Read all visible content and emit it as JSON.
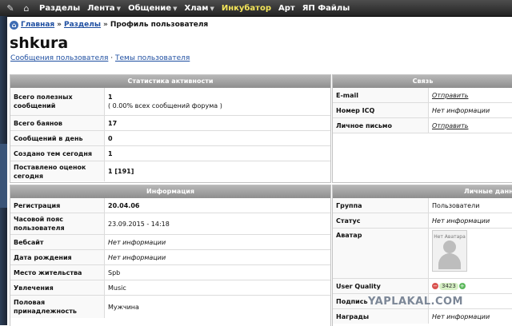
{
  "topnav": {
    "items": [
      {
        "label": "Разделы",
        "caret": false,
        "highlight": false
      },
      {
        "label": "Лента",
        "caret": true,
        "highlight": false
      },
      {
        "label": "Общение",
        "caret": true,
        "highlight": false
      },
      {
        "label": "Хлам",
        "caret": true,
        "highlight": false
      },
      {
        "label": "Инкубатор",
        "caret": false,
        "highlight": true
      },
      {
        "label": "Арт",
        "caret": false,
        "highlight": false
      },
      {
        "label": "ЯП Файлы",
        "caret": false,
        "highlight": false
      }
    ]
  },
  "breadcrumb": {
    "home": "Главная",
    "section": "Разделы",
    "current": "Профиль пользователя",
    "sep": "»"
  },
  "profile": {
    "username": "shkura",
    "links": {
      "posts": "Сообщения пользователя",
      "dot": "·",
      "topics": "Темы пользователя"
    }
  },
  "stats": {
    "title": "Статистика активности",
    "rows": [
      {
        "key": "Всего полезных сообщений",
        "value": "1",
        "sub": "( 0.00% всех сообщений форума )"
      },
      {
        "key": "Всего баянов",
        "value": "17"
      },
      {
        "key": "Сообщений в день",
        "value": "0"
      },
      {
        "key": "Создано тем сегодня",
        "value": "1"
      },
      {
        "key": "Поставлено оценок сегодня",
        "value": "1 [191]"
      }
    ]
  },
  "contact": {
    "title": "Связь",
    "rows": [
      {
        "key": "E-mail",
        "value": "Отправить"
      },
      {
        "key": "Номер ICQ",
        "value": "Нет информации"
      },
      {
        "key": "Личное письмо",
        "value": "Отправить"
      }
    ]
  },
  "info": {
    "title": "Информация",
    "rows": [
      {
        "key": "Регистрация",
        "value": "20.04.06"
      },
      {
        "key": "Часовой пояс пользователя",
        "value": "23.09.2015 - 14:18"
      },
      {
        "key": "Вебсайт",
        "value": "Нет информации"
      },
      {
        "key": "Дата рождения",
        "value": "Нет информации"
      },
      {
        "key": "Место жительства",
        "value": "Spb"
      },
      {
        "key": "Увлечения",
        "value": "Music"
      },
      {
        "key": "Половая принадлежность",
        "value": "Мужчина"
      }
    ]
  },
  "personal": {
    "title": "Личные данные",
    "rows": [
      {
        "key": "Группа",
        "value": "Пользователи"
      },
      {
        "key": "Статус",
        "value": "Нет информации"
      },
      {
        "key": "Аватар",
        "value": "Нет Аватара"
      },
      {
        "key": "User Quality",
        "minus": "−",
        "value": "3423",
        "plus": "+"
      },
      {
        "key": "Подпись",
        "value": ""
      },
      {
        "key": "Награды",
        "value": "Нет информации"
      }
    ]
  },
  "watermark": "YAPLAKAL.COM"
}
